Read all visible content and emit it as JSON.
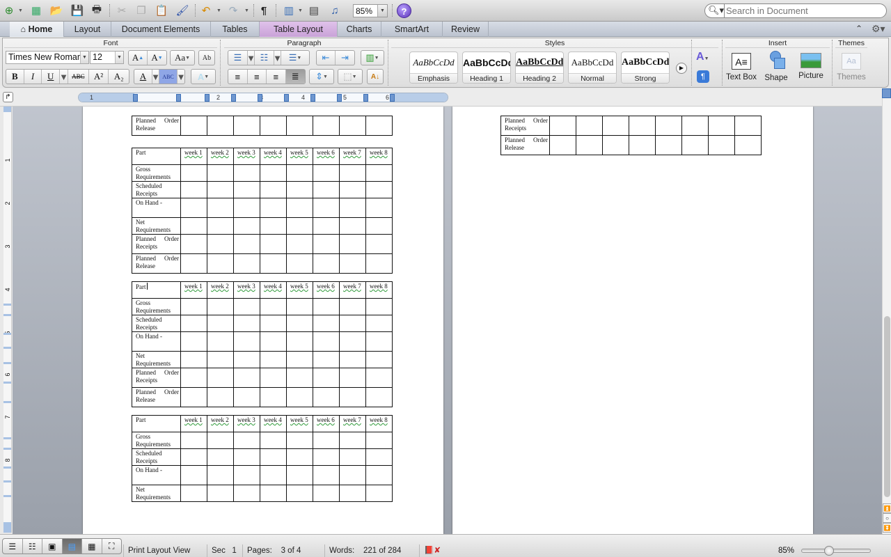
{
  "toolbar": {
    "zoom_value": "85%",
    "search_placeholder": "Search in Document",
    "icons": [
      "new-document-icon",
      "gallery-icon",
      "open-icon",
      "save-icon",
      "print-icon",
      "cut-icon",
      "copy-icon",
      "paste-icon",
      "format-painter-icon",
      "undo-icon",
      "redo-icon",
      "pilcrow-icon",
      "sidebar-icon",
      "toolbox-icon",
      "media-browser-icon",
      "help-icon"
    ]
  },
  "ribbon_tabs": [
    {
      "label": "Home",
      "active": true
    },
    {
      "label": "Layout"
    },
    {
      "label": "Document Elements"
    },
    {
      "label": "Tables"
    },
    {
      "label": "Table Layout",
      "contextual": true
    },
    {
      "label": "Charts"
    },
    {
      "label": "SmartArt"
    },
    {
      "label": "Review"
    }
  ],
  "ribbon": {
    "groups": {
      "font": "Font",
      "paragraph": "Paragraph",
      "styles": "Styles",
      "insert": "Insert",
      "themes": "Themes"
    },
    "font_name": "Times New Roman",
    "font_size": "12",
    "format_buttons": {
      "bold": "B",
      "italic": "I",
      "underline": "U",
      "strikethrough": "ABC",
      "superscript": "A²",
      "subscript": "A₂",
      "grow": "A▲",
      "shrink": "A▼",
      "case": "Aa",
      "clear": "Ab",
      "font_color": "A",
      "highlight": "ABC",
      "text_effects": "A"
    },
    "styles": [
      {
        "sample": "AaBbCcDd",
        "label": "Emphasis"
      },
      {
        "sample": "AaBbCcDd",
        "label": "Heading 1"
      },
      {
        "sample": "AaBbCcDd",
        "label": "Heading 2"
      },
      {
        "sample": "AaBbCcDd",
        "label": "Normal"
      },
      {
        "sample": "AaBbCcDd",
        "label": "Strong"
      }
    ],
    "insert": [
      {
        "label": "Text Box"
      },
      {
        "label": "Shape"
      },
      {
        "label": "Picture"
      }
    ],
    "themes_label": "Themes"
  },
  "ruler": {
    "h_numbers": [
      "1",
      "2",
      "3",
      "4",
      "5",
      "6"
    ],
    "v_numbers": [
      "1",
      "2",
      "3",
      "4",
      "5",
      "6",
      "7",
      "8"
    ]
  },
  "document": {
    "row_labels": {
      "part": "Part",
      "gross": "Gross Requirements",
      "scheduled": "Scheduled Receipts",
      "on_hand": "On Hand -",
      "net": "Net Requirements",
      "por": "Planned Order Receipts",
      "porel": "Planned Order Release"
    },
    "week_headers": [
      "week 1",
      "week 2",
      "week 3",
      "week 4",
      "week 5",
      "week 6",
      "week 7",
      "week 8"
    ],
    "left_page_tables": [
      {
        "rows": [
          "Planned Order Release"
        ],
        "has_header": false
      },
      {
        "rows": [
          "Gross Requirements",
          "Scheduled Receipts",
          "On Hand -",
          "Net Requirements",
          "Planned Order Receipts",
          "Planned Order Release"
        ],
        "has_header": true
      },
      {
        "rows": [
          "Gross Requirements",
          "Scheduled Receipts",
          "On Hand -",
          "Net Requirements",
          "Planned Order Receipts",
          "Planned Order Release"
        ],
        "has_header": true,
        "cursor_in_header": true
      },
      {
        "rows": [
          "Gross Requirements",
          "Scheduled Receipts",
          "On Hand -",
          "Net Requirements"
        ],
        "has_header": true
      }
    ],
    "right_page_tables": [
      {
        "rows": [
          "Planned Order Receipts",
          "Planned Order Release"
        ],
        "has_header": false
      }
    ]
  },
  "statusbar": {
    "view": "Print Layout View",
    "section_label": "Sec",
    "section_value": "1",
    "pages_label": "Pages:",
    "pages_value": "3 of 4",
    "words_label": "Words:",
    "words_value": "221 of 284",
    "zoom_percent": "85%",
    "zoom_level": 0.85
  }
}
